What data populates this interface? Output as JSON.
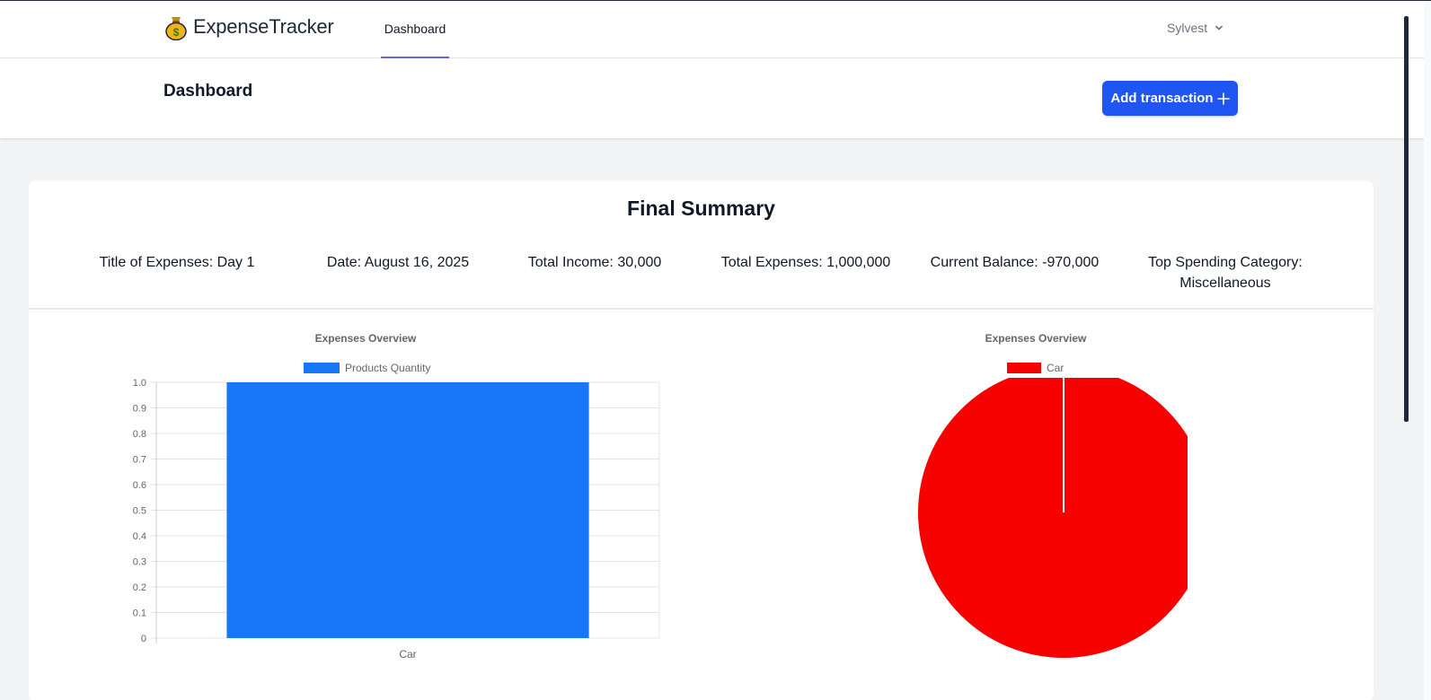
{
  "app": {
    "name": "ExpenseTracker"
  },
  "nav": {
    "links": [
      {
        "label": "Dashboard"
      }
    ]
  },
  "user": {
    "name": "Sylvest"
  },
  "header": {
    "title": "Dashboard",
    "add_button_label": "Add transaction"
  },
  "summary": {
    "title": "Final Summary",
    "items": [
      {
        "text": "Title of Expenses: Day 1"
      },
      {
        "text": "Date: August 16, 2025"
      },
      {
        "text": "Total Income: 30,000"
      },
      {
        "text": "Total Expenses: 1,000,000"
      },
      {
        "text": "Current Balance: -970,000"
      },
      {
        "line1": "Top Spending Category:",
        "line2": "Miscellaneous"
      }
    ]
  },
  "colors": {
    "accent": "#1f55f0",
    "bar": "#1877f7",
    "pie": "#f70000"
  },
  "chart_data": [
    {
      "type": "bar",
      "title": "Expenses Overview",
      "categories": [
        "Car"
      ],
      "series": [
        {
          "name": "Products Quantity",
          "values": [
            1
          ]
        }
      ],
      "ylim": [
        0,
        1
      ],
      "yticks": [
        "0",
        "0.1",
        "0.2",
        "0.3",
        "0.4",
        "0.5",
        "0.6",
        "0.7",
        "0.8",
        "0.9",
        "1.0"
      ],
      "grid": true,
      "legend": "top"
    },
    {
      "type": "pie",
      "title": "Expenses Overview",
      "labels": [
        "Car"
      ],
      "values": [
        1
      ],
      "legend": "top"
    }
  ]
}
